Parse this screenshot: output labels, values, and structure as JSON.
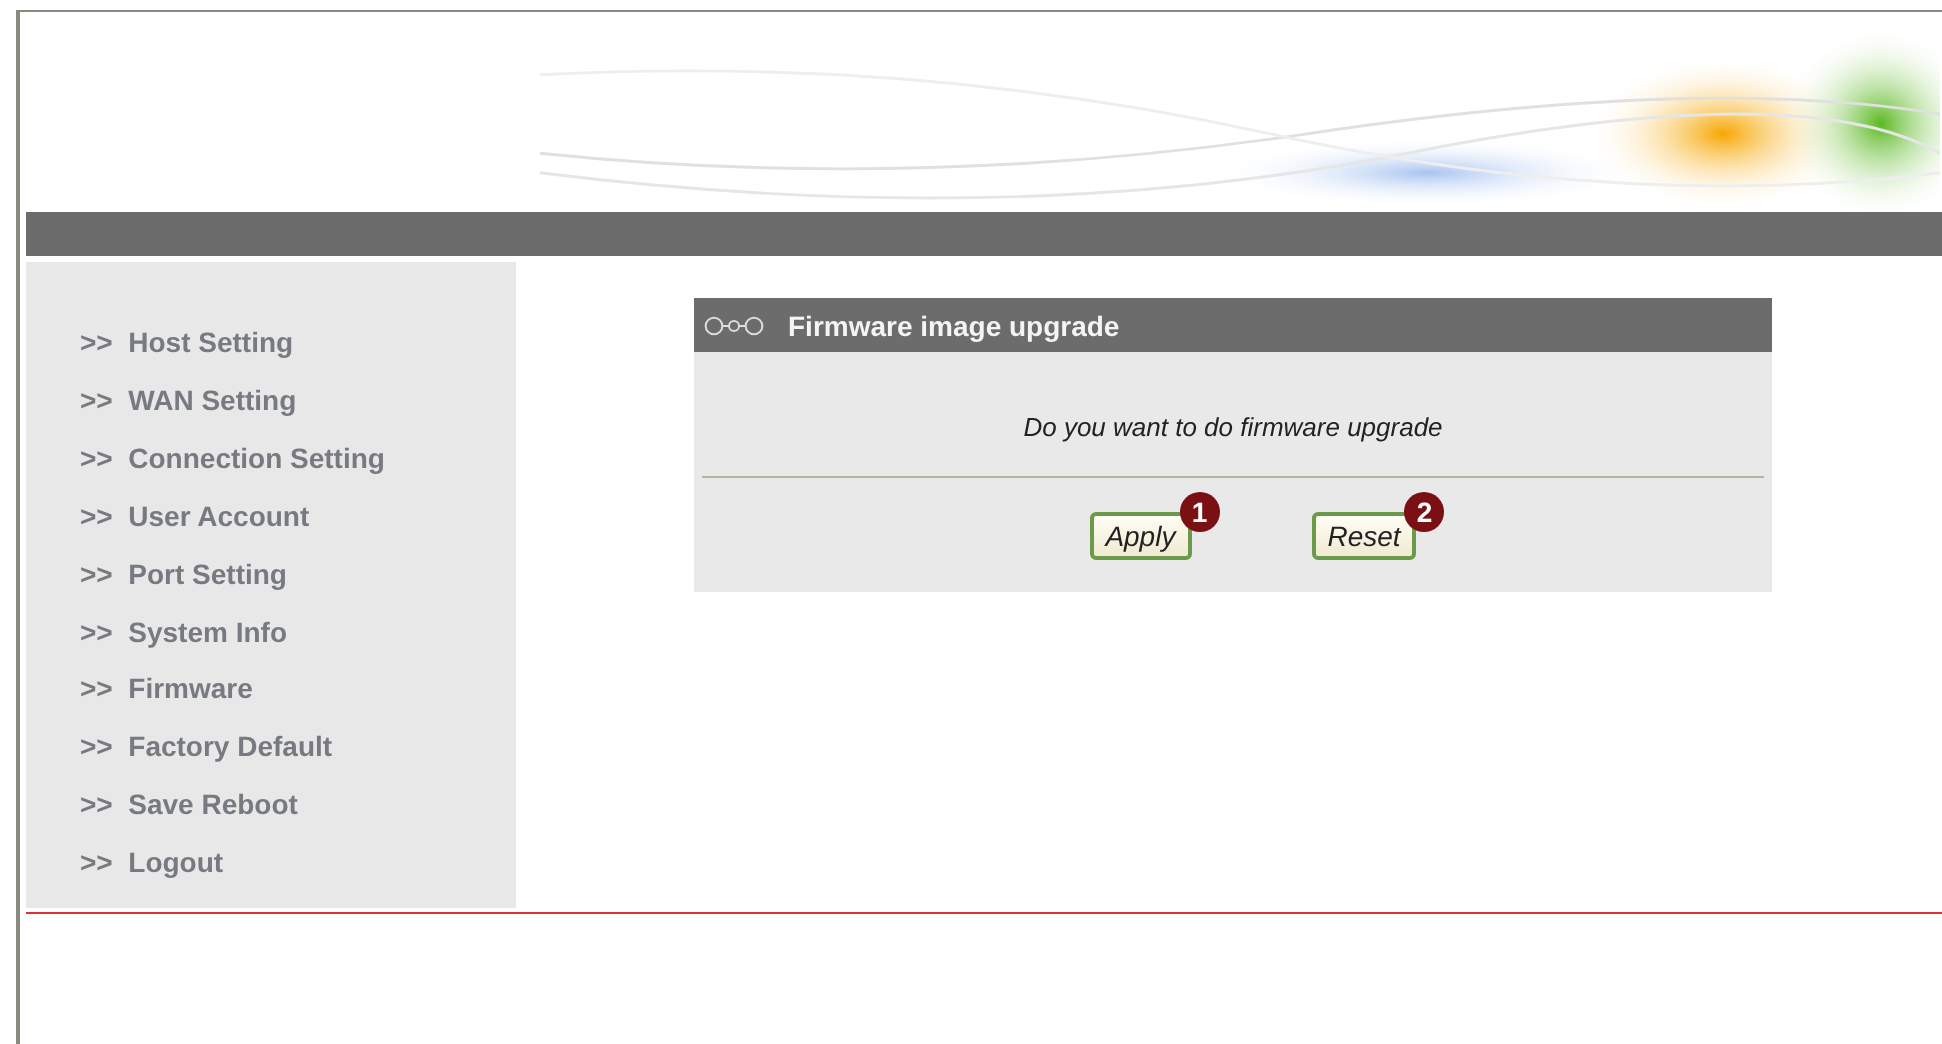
{
  "sidebar": {
    "items": [
      {
        "arrow": ">>",
        "label": "Host Setting"
      },
      {
        "arrow": ">>",
        "label": "WAN Setting"
      },
      {
        "arrow": ">>",
        "label": "Connection Setting"
      },
      {
        "arrow": ">>",
        "label": "User Account"
      },
      {
        "arrow": ">>",
        "label": "Port Setting"
      },
      {
        "arrow": ">>",
        "label": "System Info"
      },
      {
        "arrow": ">>",
        "label": "Firmware"
      },
      {
        "arrow": ">>",
        "label": "Factory Default"
      },
      {
        "arrow": ">>",
        "label": "Save Reboot"
      },
      {
        "arrow": ">>",
        "label": "Logout"
      }
    ]
  },
  "panel": {
    "title": "Firmware image upgrade",
    "message": "Do you want to do firmware upgrade",
    "buttons": [
      {
        "label": "Apply",
        "badge": "1"
      },
      {
        "label": "Reset",
        "badge": "2"
      }
    ]
  }
}
